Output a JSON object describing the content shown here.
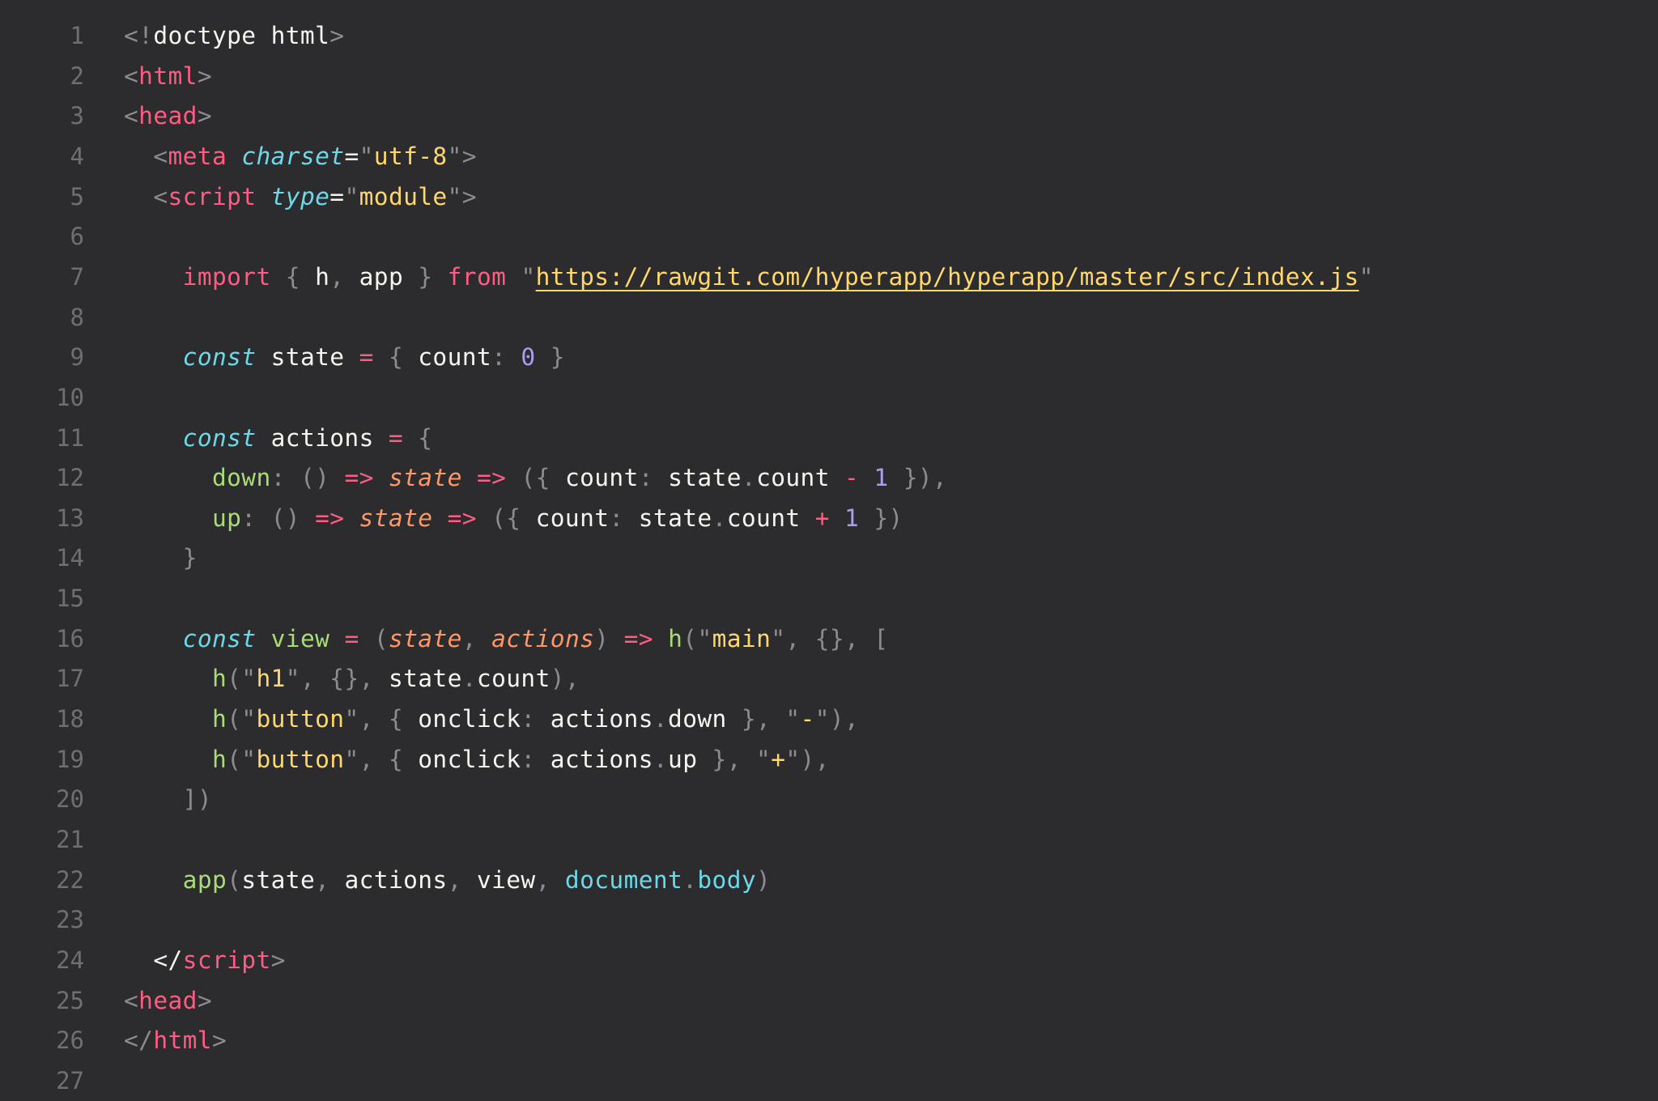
{
  "editor": {
    "theme": {
      "background": "#2c2b2e",
      "gutter": "#6f6e72",
      "text": "#f7f5f0",
      "punctuation": "#8c8b8f",
      "tag": "#ff5c84",
      "attribute": "#6cd8e8",
      "string": "#ffd76b",
      "number": "#ab9df2",
      "function": "#a9dc76",
      "parameter": "#fc9867"
    },
    "lines": [
      {
        "n": "1",
        "tokens": [
          [
            "punct",
            "<!"
          ],
          [
            "var",
            "doctype html"
          ],
          [
            "punct",
            ">"
          ]
        ]
      },
      {
        "n": "2",
        "tokens": [
          [
            "punct",
            "<"
          ],
          [
            "tag",
            "html"
          ],
          [
            "punct",
            ">"
          ]
        ]
      },
      {
        "n": "3",
        "tokens": [
          [
            "punct",
            "<"
          ],
          [
            "tag",
            "head"
          ],
          [
            "punct",
            ">"
          ]
        ]
      },
      {
        "n": "4",
        "tokens": [
          [
            "punct",
            "  <"
          ],
          [
            "tag",
            "meta"
          ],
          [
            "var",
            " "
          ],
          [
            "attr",
            "charset"
          ],
          [
            "var",
            "="
          ],
          [
            "punct",
            "\""
          ],
          [
            "str",
            "utf-8"
          ],
          [
            "punct",
            "\">"
          ]
        ]
      },
      {
        "n": "5",
        "tokens": [
          [
            "punct",
            "  <"
          ],
          [
            "tag",
            "script"
          ],
          [
            "var",
            " "
          ],
          [
            "attr",
            "type"
          ],
          [
            "var",
            "="
          ],
          [
            "punct",
            "\""
          ],
          [
            "str",
            "module"
          ],
          [
            "punct",
            "\">"
          ]
        ]
      },
      {
        "n": "6",
        "tokens": []
      },
      {
        "n": "7",
        "tokens": [
          [
            "var",
            "    "
          ],
          [
            "kw",
            "import"
          ],
          [
            "var",
            " "
          ],
          [
            "punct",
            "{"
          ],
          [
            "var",
            " h"
          ],
          [
            "punct",
            ","
          ],
          [
            "var",
            " app "
          ],
          [
            "punct",
            "}"
          ],
          [
            "var",
            " "
          ],
          [
            "kw",
            "from"
          ],
          [
            "var",
            " "
          ],
          [
            "punct",
            "\""
          ],
          [
            "link",
            "https://rawgit.com/hyperapp/hyperapp/master/src/index.js"
          ],
          [
            "punct",
            "\""
          ]
        ]
      },
      {
        "n": "8",
        "tokens": []
      },
      {
        "n": "9",
        "tokens": [
          [
            "var",
            "    "
          ],
          [
            "storage",
            "const"
          ],
          [
            "var",
            " state "
          ],
          [
            "op",
            "="
          ],
          [
            "var",
            " "
          ],
          [
            "punct",
            "{"
          ],
          [
            "var",
            " count"
          ],
          [
            "punct",
            ":"
          ],
          [
            "var",
            " "
          ],
          [
            "num",
            "0"
          ],
          [
            "var",
            " "
          ],
          [
            "punct",
            "}"
          ]
        ]
      },
      {
        "n": "10",
        "tokens": []
      },
      {
        "n": "11",
        "tokens": [
          [
            "var",
            "    "
          ],
          [
            "storage",
            "const"
          ],
          [
            "var",
            " actions "
          ],
          [
            "op",
            "="
          ],
          [
            "var",
            " "
          ],
          [
            "punct",
            "{"
          ]
        ]
      },
      {
        "n": "12",
        "tokens": [
          [
            "var",
            "      "
          ],
          [
            "fn",
            "down"
          ],
          [
            "punct",
            ":"
          ],
          [
            "var",
            " "
          ],
          [
            "punct",
            "()"
          ],
          [
            "var",
            " "
          ],
          [
            "op",
            "=>"
          ],
          [
            "var",
            " "
          ],
          [
            "param",
            "state"
          ],
          [
            "var",
            " "
          ],
          [
            "op",
            "=>"
          ],
          [
            "var",
            " "
          ],
          [
            "punct",
            "({"
          ],
          [
            "var",
            " count"
          ],
          [
            "punct",
            ":"
          ],
          [
            "var",
            " state"
          ],
          [
            "punct",
            "."
          ],
          [
            "var",
            "count "
          ],
          [
            "op",
            "-"
          ],
          [
            "var",
            " "
          ],
          [
            "num",
            "1"
          ],
          [
            "var",
            " "
          ],
          [
            "punct",
            "}),"
          ]
        ]
      },
      {
        "n": "13",
        "tokens": [
          [
            "var",
            "      "
          ],
          [
            "fn",
            "up"
          ],
          [
            "punct",
            ":"
          ],
          [
            "var",
            " "
          ],
          [
            "punct",
            "()"
          ],
          [
            "var",
            " "
          ],
          [
            "op",
            "=>"
          ],
          [
            "var",
            " "
          ],
          [
            "param",
            "state"
          ],
          [
            "var",
            " "
          ],
          [
            "op",
            "=>"
          ],
          [
            "var",
            " "
          ],
          [
            "punct",
            "({"
          ],
          [
            "var",
            " count"
          ],
          [
            "punct",
            ":"
          ],
          [
            "var",
            " state"
          ],
          [
            "punct",
            "."
          ],
          [
            "var",
            "count "
          ],
          [
            "op",
            "+"
          ],
          [
            "var",
            " "
          ],
          [
            "num",
            "1"
          ],
          [
            "var",
            " "
          ],
          [
            "punct",
            "})"
          ]
        ]
      },
      {
        "n": "14",
        "tokens": [
          [
            "var",
            "    "
          ],
          [
            "punct",
            "}"
          ]
        ]
      },
      {
        "n": "15",
        "tokens": []
      },
      {
        "n": "16",
        "tokens": [
          [
            "var",
            "    "
          ],
          [
            "storage",
            "const"
          ],
          [
            "var",
            " "
          ],
          [
            "fn",
            "view"
          ],
          [
            "var",
            " "
          ],
          [
            "op",
            "="
          ],
          [
            "var",
            " "
          ],
          [
            "punct",
            "("
          ],
          [
            "param",
            "state"
          ],
          [
            "punct",
            ","
          ],
          [
            "var",
            " "
          ],
          [
            "param",
            "actions"
          ],
          [
            "punct",
            ")"
          ],
          [
            "var",
            " "
          ],
          [
            "op",
            "=>"
          ],
          [
            "var",
            " "
          ],
          [
            "fn",
            "h"
          ],
          [
            "punct",
            "(\""
          ],
          [
            "str",
            "main"
          ],
          [
            "punct",
            "\","
          ],
          [
            "var",
            " "
          ],
          [
            "punct",
            "{},"
          ],
          [
            "var",
            " "
          ],
          [
            "punct",
            "["
          ]
        ]
      },
      {
        "n": "17",
        "tokens": [
          [
            "var",
            "      "
          ],
          [
            "fn",
            "h"
          ],
          [
            "punct",
            "(\""
          ],
          [
            "str",
            "h1"
          ],
          [
            "punct",
            "\","
          ],
          [
            "var",
            " "
          ],
          [
            "punct",
            "{},"
          ],
          [
            "var",
            " state"
          ],
          [
            "punct",
            "."
          ],
          [
            "var",
            "count"
          ],
          [
            "punct",
            "),"
          ]
        ]
      },
      {
        "n": "18",
        "tokens": [
          [
            "var",
            "      "
          ],
          [
            "fn",
            "h"
          ],
          [
            "punct",
            "(\""
          ],
          [
            "str",
            "button"
          ],
          [
            "punct",
            "\","
          ],
          [
            "var",
            " "
          ],
          [
            "punct",
            "{"
          ],
          [
            "var",
            " onclick"
          ],
          [
            "punct",
            ":"
          ],
          [
            "var",
            " actions"
          ],
          [
            "punct",
            "."
          ],
          [
            "var",
            "down "
          ],
          [
            "punct",
            "},"
          ],
          [
            "var",
            " "
          ],
          [
            "punct",
            "\""
          ],
          [
            "str",
            "-"
          ],
          [
            "punct",
            "\"),"
          ]
        ]
      },
      {
        "n": "19",
        "tokens": [
          [
            "var",
            "      "
          ],
          [
            "fn",
            "h"
          ],
          [
            "punct",
            "(\""
          ],
          [
            "str",
            "button"
          ],
          [
            "punct",
            "\","
          ],
          [
            "var",
            " "
          ],
          [
            "punct",
            "{"
          ],
          [
            "var",
            " onclick"
          ],
          [
            "punct",
            ":"
          ],
          [
            "var",
            " actions"
          ],
          [
            "punct",
            "."
          ],
          [
            "var",
            "up "
          ],
          [
            "punct",
            "},"
          ],
          [
            "var",
            " "
          ],
          [
            "punct",
            "\""
          ],
          [
            "str",
            "+"
          ],
          [
            "punct",
            "\"),"
          ]
        ]
      },
      {
        "n": "20",
        "tokens": [
          [
            "var",
            "    "
          ],
          [
            "punct",
            "])"
          ]
        ]
      },
      {
        "n": "21",
        "tokens": []
      },
      {
        "n": "22",
        "tokens": [
          [
            "var",
            "    "
          ],
          [
            "fn",
            "app"
          ],
          [
            "punct",
            "("
          ],
          [
            "var",
            "state"
          ],
          [
            "punct",
            ","
          ],
          [
            "var",
            " actions"
          ],
          [
            "punct",
            ","
          ],
          [
            "var",
            " view"
          ],
          [
            "punct",
            ","
          ],
          [
            "var",
            " "
          ],
          [
            "support",
            "document"
          ],
          [
            "punct",
            "."
          ],
          [
            "support",
            "body"
          ],
          [
            "punct",
            ")"
          ]
        ]
      },
      {
        "n": "23",
        "tokens": []
      },
      {
        "n": "24",
        "tokens": [
          [
            "var",
            "  </"
          ],
          [
            "tag",
            "script"
          ],
          [
            "punct",
            ">"
          ]
        ]
      },
      {
        "n": "25",
        "tokens": [
          [
            "punct",
            "<"
          ],
          [
            "tag",
            "head"
          ],
          [
            "punct",
            ">"
          ]
        ]
      },
      {
        "n": "26",
        "tokens": [
          [
            "punct",
            "</"
          ],
          [
            "tag",
            "html"
          ],
          [
            "punct",
            ">"
          ]
        ]
      },
      {
        "n": "27",
        "tokens": []
      }
    ]
  }
}
